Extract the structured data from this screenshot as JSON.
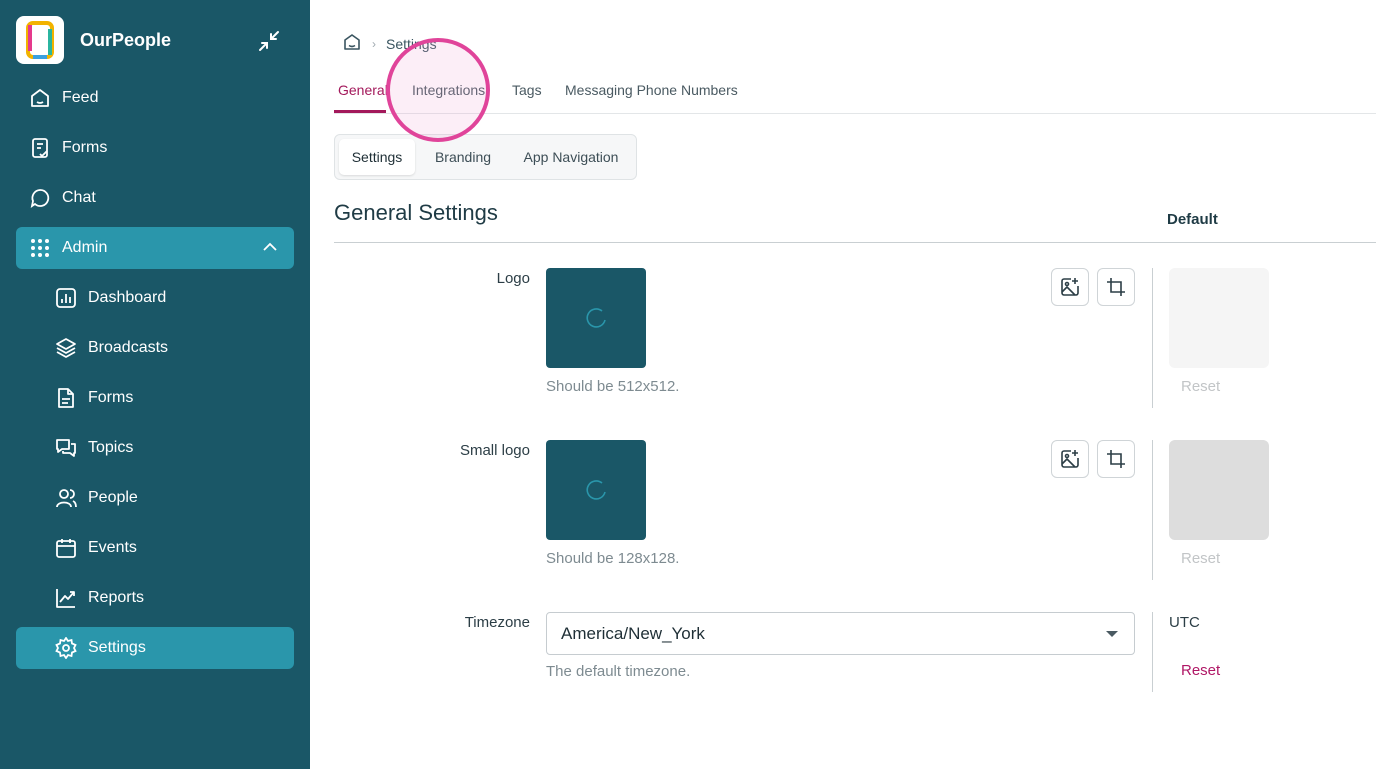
{
  "app": {
    "name": "OurPeople"
  },
  "sidebar": {
    "items": [
      {
        "label": "Feed",
        "icon": "home-icon"
      },
      {
        "label": "Forms",
        "icon": "form-check-icon"
      },
      {
        "label": "Chat",
        "icon": "chat-bubble-icon"
      },
      {
        "label": "Admin",
        "icon": "grid-dots-icon"
      }
    ],
    "admin_items": [
      {
        "label": "Dashboard",
        "icon": "bar-chart-icon"
      },
      {
        "label": "Broadcasts",
        "icon": "layers-icon"
      },
      {
        "label": "Forms",
        "icon": "document-icon"
      },
      {
        "label": "Topics",
        "icon": "chat-bubbles-icon"
      },
      {
        "label": "People",
        "icon": "users-icon"
      },
      {
        "label": "Events",
        "icon": "calendar-icon"
      },
      {
        "label": "Reports",
        "icon": "line-chart-icon"
      },
      {
        "label": "Settings",
        "icon": "gear-icon"
      }
    ]
  },
  "breadcrumb": {
    "current": "Settings"
  },
  "tabs": [
    "General",
    "Integrations",
    "Tags",
    "Messaging Phone Numbers"
  ],
  "subtabs": [
    "Settings",
    "Branding",
    "App Navigation"
  ],
  "section": {
    "title": "General Settings",
    "default_label": "Default"
  },
  "logo": {
    "label": "Logo",
    "hint": "Should be 512x512.",
    "reset": "Reset"
  },
  "small_logo": {
    "label": "Small logo",
    "hint": "Should be 128x128.",
    "reset": "Reset"
  },
  "timezone": {
    "label": "Timezone",
    "value": "America/New_York",
    "hint": "The default timezone.",
    "default_value": "UTC",
    "reset": "Reset"
  },
  "colors": {
    "sidebar": "#1a5767",
    "active": "#2a96ab",
    "accent": "#a3195b",
    "highlight": "#e0449a"
  }
}
